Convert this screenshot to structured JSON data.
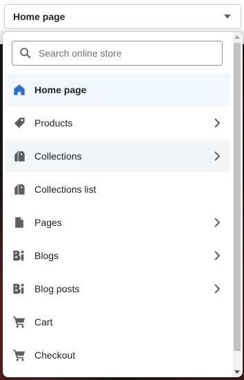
{
  "selector": {
    "value": "Home page",
    "caret_icon": "caret-down-icon"
  },
  "search": {
    "placeholder": "Search online store",
    "value": ""
  },
  "items": [
    {
      "label": "Home page",
      "icon": "home-icon",
      "has_submenu": false,
      "selected": true
    },
    {
      "label": "Products",
      "icon": "tag-icon",
      "has_submenu": true,
      "selected": false
    },
    {
      "label": "Collections",
      "icon": "collection-icon",
      "has_submenu": true,
      "selected": false
    },
    {
      "label": "Collections list",
      "icon": "collection-icon",
      "has_submenu": false,
      "selected": false
    },
    {
      "label": "Pages",
      "icon": "page-icon",
      "has_submenu": true,
      "selected": false
    },
    {
      "label": "Blogs",
      "icon": "blog-icon",
      "has_submenu": true,
      "selected": false
    },
    {
      "label": "Blog posts",
      "icon": "blog-icon",
      "has_submenu": true,
      "selected": false
    },
    {
      "label": "Cart",
      "icon": "cart-icon",
      "has_submenu": false,
      "selected": false
    },
    {
      "label": "Checkout",
      "icon": "cart-icon",
      "has_submenu": false,
      "selected": false
    }
  ],
  "colors": {
    "selected_icon": "#2c6ecb",
    "icon": "#5c5f62",
    "selected_bg": "#f2f7fe"
  }
}
